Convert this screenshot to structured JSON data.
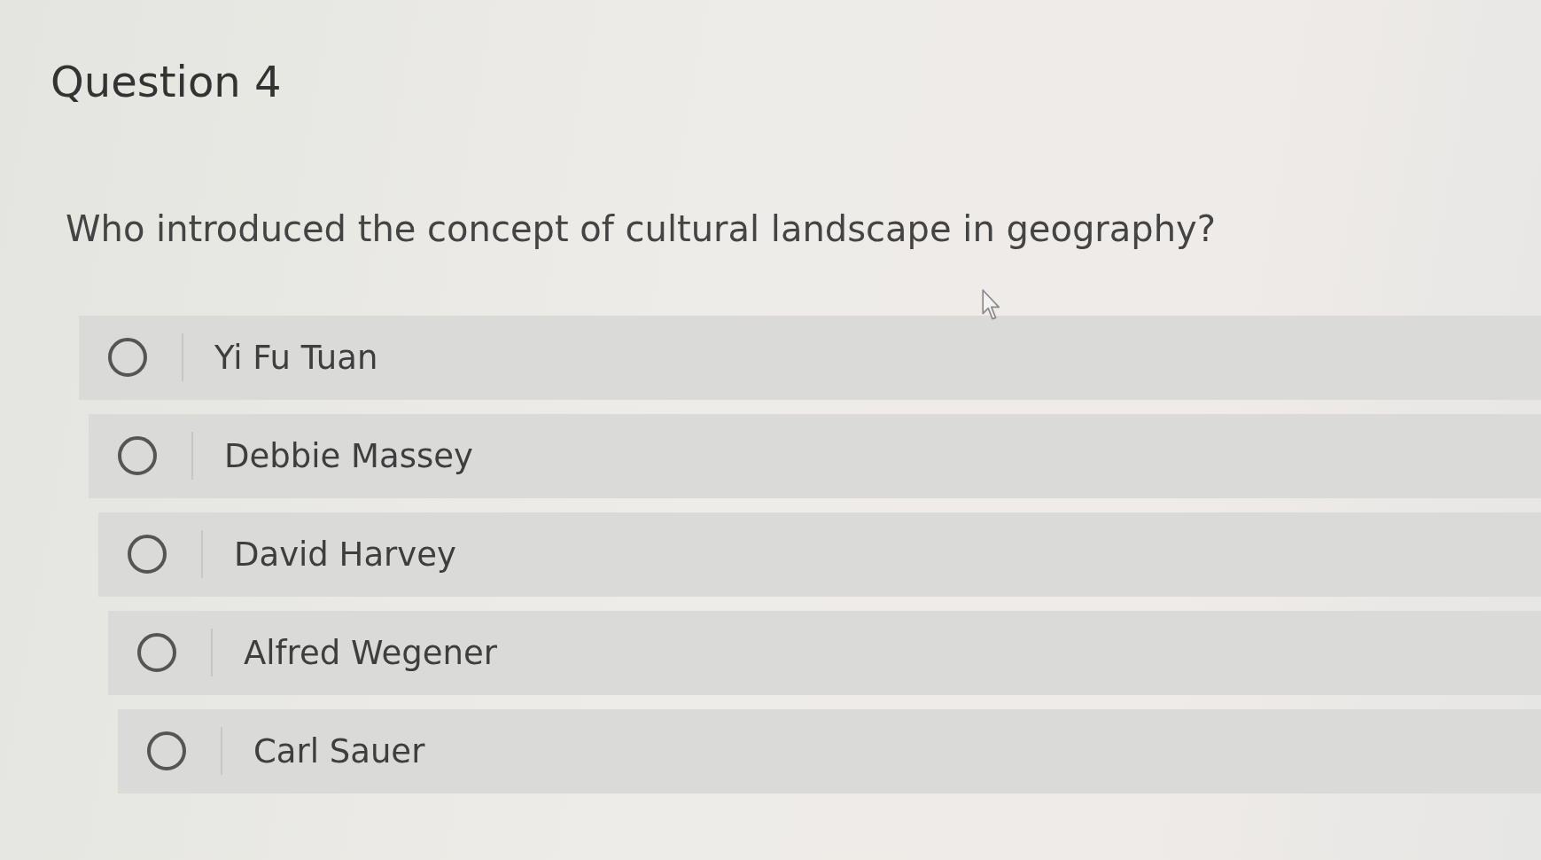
{
  "question": {
    "title": "Question 4",
    "text": "Who introduced the concept of cultural landscape in geography?"
  },
  "options": [
    {
      "label": "Yi Fu Tuan",
      "selected": false
    },
    {
      "label": "Debbie Massey",
      "selected": false
    },
    {
      "label": "David Harvey",
      "selected": false
    },
    {
      "label": "Alfred Wegener",
      "selected": false
    },
    {
      "label": "Carl Sauer",
      "selected": false
    }
  ]
}
